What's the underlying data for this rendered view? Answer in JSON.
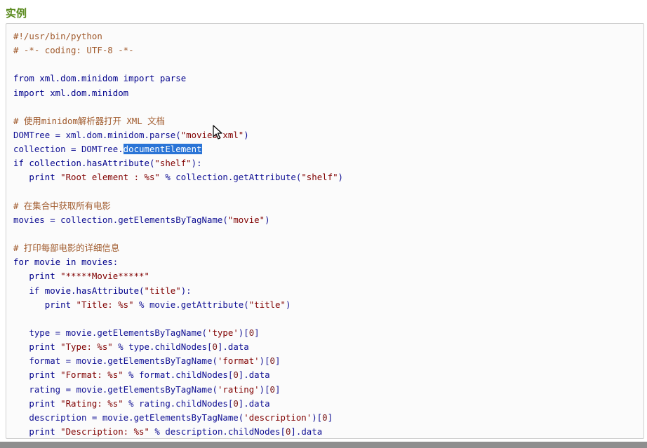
{
  "heading": "实例",
  "code_lines": [
    [
      {
        "t": "#!/usr/bin/python",
        "c": "cmt"
      }
    ],
    [
      {
        "t": "# -*- coding: UTF-8 -*-",
        "c": "cmt"
      }
    ],
    [],
    [
      {
        "t": "from xml.dom.minidom import parse",
        "c": "kw"
      }
    ],
    [
      {
        "t": "import xml.dom.minidom",
        "c": "kw"
      }
    ],
    [],
    [
      {
        "t": "# 使用minidom解析器打开 XML 文档",
        "c": "cmt"
      }
    ],
    [
      {
        "t": "DOMTree = xml.dom.minidom.parse(",
        "c": "tok"
      },
      {
        "t": "\"movies.xml\"",
        "c": "str"
      },
      {
        "t": ")",
        "c": "tok"
      }
    ],
    [
      {
        "t": "collection = DOMTree.",
        "c": "tok"
      },
      {
        "t": "documentElement",
        "c": "sel"
      }
    ],
    [
      {
        "t": "if collection.hasAttribute(",
        "c": "kw"
      },
      {
        "t": "\"shelf\"",
        "c": "str"
      },
      {
        "t": "):",
        "c": "tok"
      }
    ],
    [
      {
        "t": "   print ",
        "c": "kw"
      },
      {
        "t": "\"Root element : %s\"",
        "c": "str"
      },
      {
        "t": " % collection.getAttribute(",
        "c": "tok"
      },
      {
        "t": "\"shelf\"",
        "c": "str"
      },
      {
        "t": ")",
        "c": "tok"
      }
    ],
    [],
    [
      {
        "t": "# 在集合中获取所有电影",
        "c": "cmt"
      }
    ],
    [
      {
        "t": "movies = collection.getElementsByTagName(",
        "c": "tok"
      },
      {
        "t": "\"movie\"",
        "c": "str"
      },
      {
        "t": ")",
        "c": "tok"
      }
    ],
    [],
    [
      {
        "t": "# 打印每部电影的详细信息",
        "c": "cmt"
      }
    ],
    [
      {
        "t": "for movie in movies:",
        "c": "kw"
      }
    ],
    [
      {
        "t": "   print ",
        "c": "kw"
      },
      {
        "t": "\"*****Movie*****\"",
        "c": "str"
      }
    ],
    [
      {
        "t": "   if movie.hasAttribute(",
        "c": "kw"
      },
      {
        "t": "\"title\"",
        "c": "str"
      },
      {
        "t": "):",
        "c": "tok"
      }
    ],
    [
      {
        "t": "      print ",
        "c": "kw"
      },
      {
        "t": "\"Title: %s\"",
        "c": "str"
      },
      {
        "t": " % movie.getAttribute(",
        "c": "tok"
      },
      {
        "t": "\"title\"",
        "c": "str"
      },
      {
        "t": ")",
        "c": "tok"
      }
    ],
    [],
    [
      {
        "t": "   type = movie.getElementsByTagName(",
        "c": "tok"
      },
      {
        "t": "'type'",
        "c": "str"
      },
      {
        "t": ")[",
        "c": "tok"
      },
      {
        "t": "0",
        "c": "num"
      },
      {
        "t": "]",
        "c": "tok"
      }
    ],
    [
      {
        "t": "   print ",
        "c": "kw"
      },
      {
        "t": "\"Type: %s\"",
        "c": "str"
      },
      {
        "t": " % type.childNodes[",
        "c": "tok"
      },
      {
        "t": "0",
        "c": "num"
      },
      {
        "t": "].data",
        "c": "tok"
      }
    ],
    [
      {
        "t": "   format = movie.getElementsByTagName(",
        "c": "tok"
      },
      {
        "t": "'format'",
        "c": "str"
      },
      {
        "t": ")[",
        "c": "tok"
      },
      {
        "t": "0",
        "c": "num"
      },
      {
        "t": "]",
        "c": "tok"
      }
    ],
    [
      {
        "t": "   print ",
        "c": "kw"
      },
      {
        "t": "\"Format: %s\"",
        "c": "str"
      },
      {
        "t": " % format.childNodes[",
        "c": "tok"
      },
      {
        "t": "0",
        "c": "num"
      },
      {
        "t": "].data",
        "c": "tok"
      }
    ],
    [
      {
        "t": "   rating = movie.getElementsByTagName(",
        "c": "tok"
      },
      {
        "t": "'rating'",
        "c": "str"
      },
      {
        "t": ")[",
        "c": "tok"
      },
      {
        "t": "0",
        "c": "num"
      },
      {
        "t": "]",
        "c": "tok"
      }
    ],
    [
      {
        "t": "   print ",
        "c": "kw"
      },
      {
        "t": "\"Rating: %s\"",
        "c": "str"
      },
      {
        "t": " % rating.childNodes[",
        "c": "tok"
      },
      {
        "t": "0",
        "c": "num"
      },
      {
        "t": "].data",
        "c": "tok"
      }
    ],
    [
      {
        "t": "   description = movie.getElementsByTagName(",
        "c": "tok"
      },
      {
        "t": "'description'",
        "c": "str"
      },
      {
        "t": ")[",
        "c": "tok"
      },
      {
        "t": "0",
        "c": "num"
      },
      {
        "t": "]",
        "c": "tok"
      }
    ],
    [
      {
        "t": "   print ",
        "c": "kw"
      },
      {
        "t": "\"Description: %s\"",
        "c": "str"
      },
      {
        "t": " % description.childNodes[",
        "c": "tok"
      },
      {
        "t": "0",
        "c": "num"
      },
      {
        "t": "].data",
        "c": "tok"
      }
    ]
  ],
  "icons": {
    "cursor": "mouse-pointer-icon"
  },
  "colors": {
    "heading": "#5a8a1e",
    "selection": "#2a74d6"
  }
}
